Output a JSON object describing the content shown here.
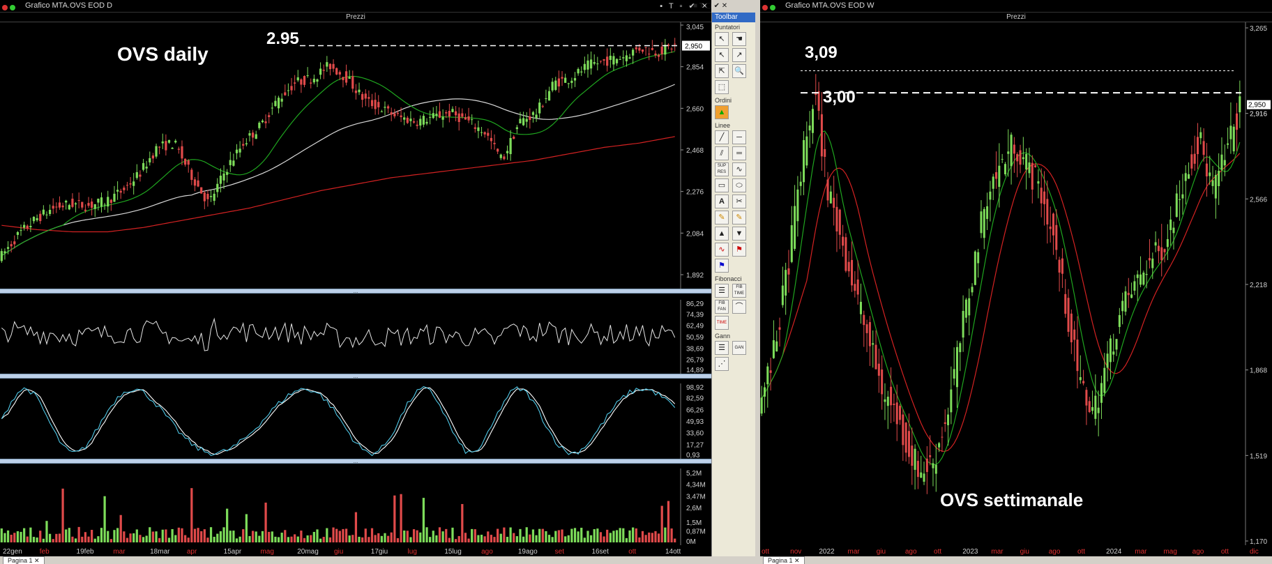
{
  "left": {
    "window_title": "Grafico MTA.OVS EOD D",
    "panel_title": "Prezzi",
    "annotation_title": "OVS daily",
    "annotation_level": "2.95",
    "price_badge": "2,950",
    "yticks": [
      "3,045",
      "2,854",
      "2,660",
      "2,468",
      "2,276",
      "2,084",
      "1,892"
    ],
    "rsi_ticks": [
      "86,29",
      "74,39",
      "62,49",
      "50,59",
      "38,69",
      "26,79",
      "14,89"
    ],
    "stoch_ticks": [
      "98,92",
      "82,59",
      "66,26",
      "49,93",
      "33,60",
      "17,27",
      "0,93"
    ],
    "vol_ticks": [
      "5,2M",
      "4,34M",
      "3,47M",
      "2,6M",
      "1,5M",
      "0,87M",
      "0M"
    ],
    "xticks": [
      "22gen",
      "feb",
      "19feb",
      "mar",
      "18mar",
      "apr",
      "15apr",
      "mag",
      "20mag",
      "giu",
      "17giu",
      "lug",
      "15lug",
      "ago",
      "19ago",
      "set",
      "16set",
      "ott",
      "14ott"
    ]
  },
  "right": {
    "window_title": "Grafico MTA.OVS EOD W",
    "panel_title": "Prezzi",
    "annotation_title": "OVS settimanale",
    "annotation_high": "3,09",
    "annotation_level": "3,00",
    "price_badge": "2,950",
    "badge2": "2,916",
    "yticks": [
      "3,265",
      "2,916",
      "2,566",
      "2,218",
      "1,868",
      "1,519",
      "1,170"
    ],
    "xticks": [
      "ott",
      "nov",
      "2022",
      "mar",
      "giu",
      "ago",
      "ott",
      "2023",
      "mar",
      "giu",
      "ago",
      "ott",
      "2024",
      "mar",
      "mag",
      "ago",
      "ott",
      "dic"
    ]
  },
  "toolbar": {
    "title": "Toolbar",
    "sections": [
      "Puntatori",
      "Ordini",
      "Linee",
      "Fibonacci",
      "Gann"
    ],
    "labels": {
      "sup_res": "SUP RES",
      "fib_time": "FIB TIME",
      "fib_fan": "FIB FAN",
      "time": "TIME",
      "gann": "GAN"
    }
  },
  "status": {
    "tab_left": "Pagina 1",
    "tab_right": "Pagina 1"
  },
  "colors": {
    "bull": "#7ddc5a",
    "bear": "#e04a4a",
    "ma_fast": "#1fa51f",
    "ma_mid": "#d9d9d9",
    "ma_slow": "#d42222",
    "stoch_k": "#4fc7e6",
    "stoch_d": "#ffffff"
  },
  "chart_data": [
    {
      "type": "candlestick",
      "title": "OVS daily",
      "period": "daily",
      "ylim": [
        1.892,
        3.045
      ],
      "close_approx": [
        1.98,
        2.08,
        2.15,
        2.2,
        2.22,
        2.21,
        2.23,
        2.28,
        2.36,
        2.48,
        2.5,
        2.35,
        2.22,
        2.38,
        2.5,
        2.58,
        2.7,
        2.78,
        2.8,
        2.86,
        2.8,
        2.7,
        2.66,
        2.62,
        2.6,
        2.62,
        2.64,
        2.6,
        2.55,
        2.42,
        2.6,
        2.64,
        2.78,
        2.8,
        2.86,
        2.88,
        2.9,
        2.94,
        2.92,
        2.95
      ],
      "lines": [
        {
          "name": "level",
          "y": 2.95
        },
        {
          "name": "ma_slow_approx",
          "y": [
            2.12,
            2.1,
            2.09,
            2.09,
            2.11,
            2.14,
            2.17,
            2.2,
            2.24,
            2.28,
            2.31,
            2.34,
            2.36,
            2.38,
            2.4,
            2.42,
            2.45,
            2.48,
            2.5,
            2.53
          ]
        }
      ]
    },
    {
      "type": "line",
      "name": "RSI",
      "ylim": [
        14.89,
        86.29
      ]
    },
    {
      "type": "line",
      "name": "Stochastic",
      "ylim": [
        0.93,
        98.92
      ]
    },
    {
      "type": "bar",
      "name": "Volume",
      "ylim": [
        0,
        5.2
      ]
    },
    {
      "type": "candlestick",
      "title": "OVS settimanale",
      "period": "weekly",
      "ylim": [
        1.17,
        3.265
      ],
      "close_approx": [
        1.75,
        1.95,
        2.3,
        2.7,
        3.0,
        2.6,
        2.4,
        2.2,
        2.0,
        1.8,
        1.7,
        1.55,
        1.45,
        1.5,
        1.7,
        2.0,
        2.3,
        2.6,
        2.7,
        2.8,
        2.7,
        2.6,
        2.4,
        2.1,
        1.8,
        1.7,
        1.9,
        2.1,
        2.2,
        2.3,
        2.35,
        2.5,
        2.7,
        2.8,
        2.6,
        2.75,
        2.95
      ],
      "lines": [
        {
          "name": "high",
          "y": 3.09
        },
        {
          "name": "level",
          "y": 3.0
        }
      ]
    }
  ]
}
